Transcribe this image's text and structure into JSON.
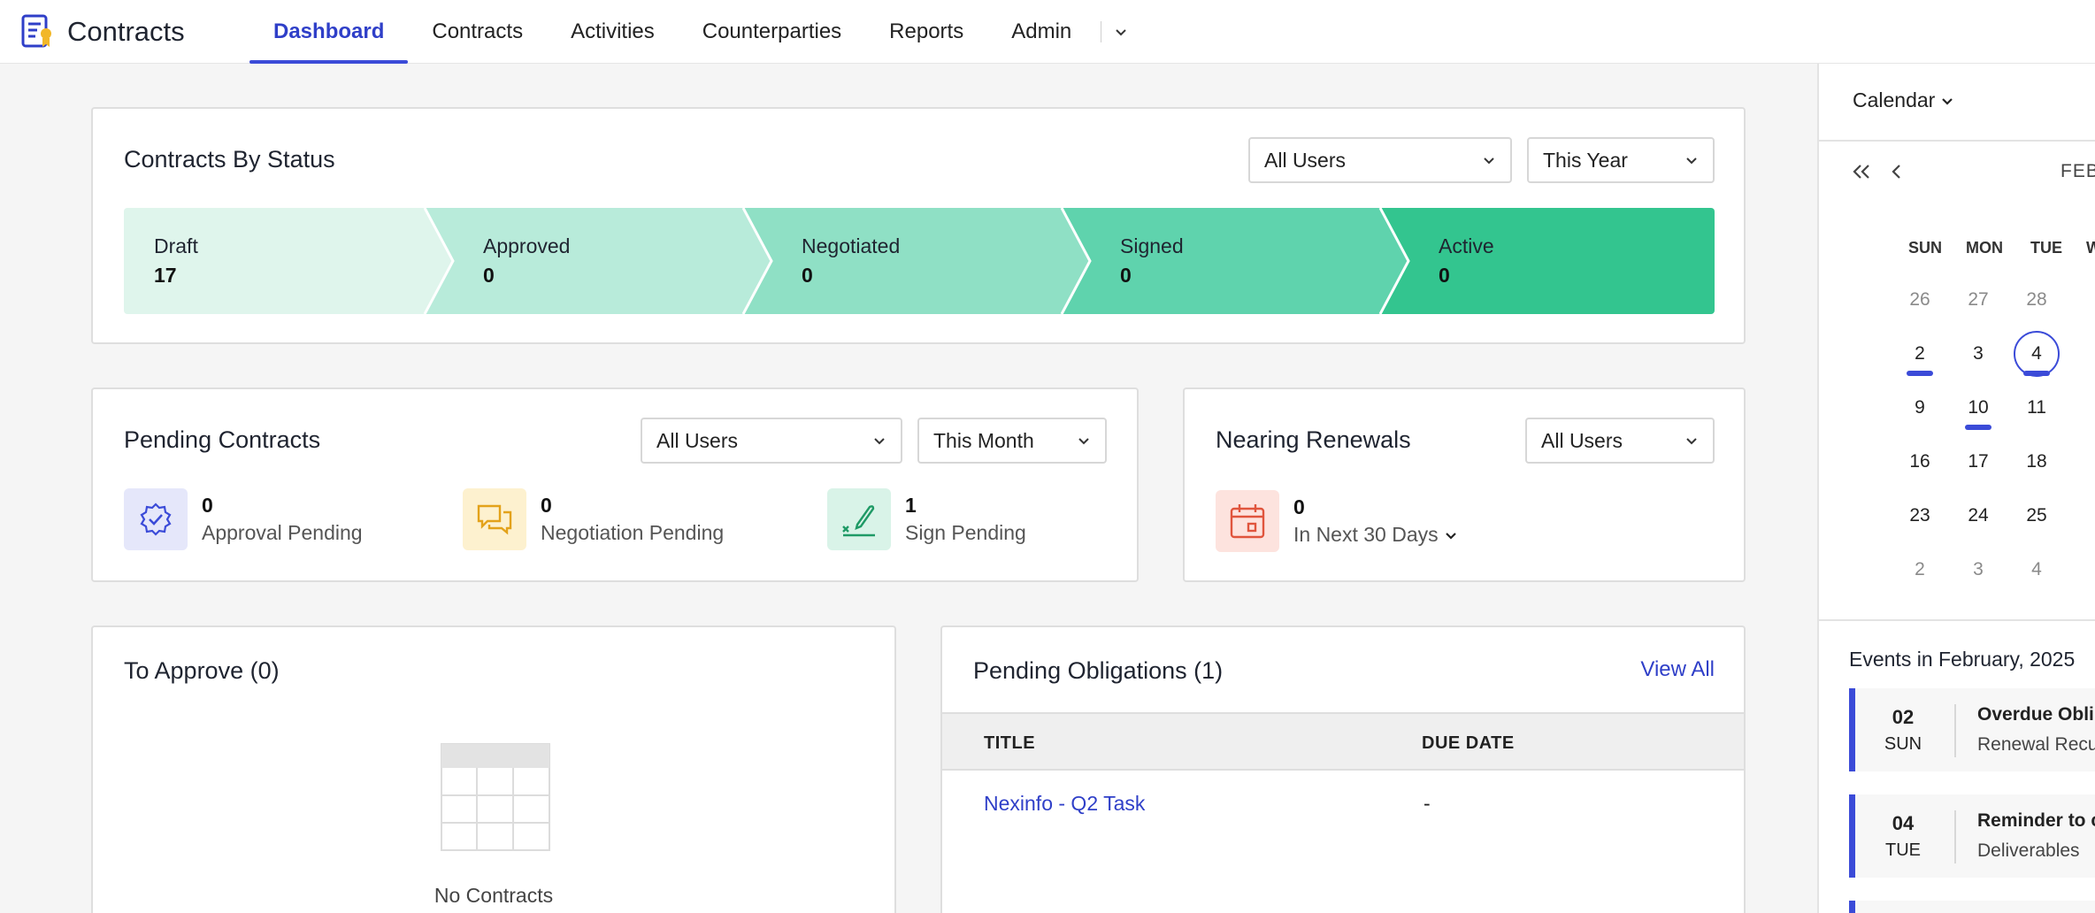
{
  "app": {
    "name": "Contracts"
  },
  "nav": {
    "tabs": [
      {
        "label": "Dashboard"
      },
      {
        "label": "Contracts"
      },
      {
        "label": "Activities"
      },
      {
        "label": "Counterparties"
      },
      {
        "label": "Reports"
      },
      {
        "label": "Admin"
      }
    ]
  },
  "status_card": {
    "title": "Contracts By Status",
    "filter_users": "All Users",
    "filter_period": "This Year",
    "stages": [
      {
        "name": "Draft",
        "count": "17",
        "color": "#dff5ec"
      },
      {
        "name": "Approved",
        "count": "0",
        "color": "#b8ebda"
      },
      {
        "name": "Negotiated",
        "count": "0",
        "color": "#8fe0c5"
      },
      {
        "name": "Signed",
        "count": "0",
        "color": "#5fd3ad"
      },
      {
        "name": "Active",
        "count": "0",
        "color": "#33c58f"
      }
    ]
  },
  "pending_card": {
    "title": "Pending Contracts",
    "filter_users": "All Users",
    "filter_period": "This Month",
    "items": [
      {
        "count": "0",
        "label": "Approval Pending",
        "icon": "verified-badge-icon",
        "bg": "#e5e7fa",
        "fg": "#3b4bd8"
      },
      {
        "count": "0",
        "label": "Negotiation Pending",
        "icon": "chat-bubbles-icon",
        "bg": "#fdf1cf",
        "fg": "#e3a21a"
      },
      {
        "count": "1",
        "label": "Sign Pending",
        "icon": "signature-pen-icon",
        "bg": "#d9f3e8",
        "fg": "#1f9a66"
      }
    ]
  },
  "renewals_card": {
    "title": "Nearing Renewals",
    "filter_users": "All Users",
    "count": "0",
    "period_label": "In Next 30 Days",
    "icon": "calendar-icon",
    "bg": "#fde3de",
    "fg": "#e0553d"
  },
  "approve_card": {
    "title": "To Approve (0)",
    "empty_text": "No Contracts"
  },
  "obligations_card": {
    "title": "Pending Obligations (1)",
    "view_all": "View All",
    "columns": [
      "TITLE",
      "DUE DATE"
    ],
    "rows": [
      {
        "title": "Nexinfo - Q2 Task",
        "due": "-"
      }
    ]
  },
  "calendar": {
    "header": "Calendar",
    "month_label": "FEB",
    "weekdays": [
      "SUN",
      "MON",
      "TUE",
      "W"
    ],
    "weeks": [
      [
        "26",
        "27",
        "28"
      ],
      [
        "2",
        "3",
        "4"
      ],
      [
        "9",
        "10",
        "11"
      ],
      [
        "16",
        "17",
        "18"
      ],
      [
        "23",
        "24",
        "25"
      ],
      [
        "2",
        "3",
        "4"
      ]
    ],
    "today": "4",
    "events_title": "Events in February, 2025",
    "events": [
      {
        "day": "02",
        "weekday": "SUN",
        "title": "Overdue Obli",
        "subtitle": "Renewal Recu"
      },
      {
        "day": "04",
        "weekday": "TUE",
        "title": "Reminder to c",
        "subtitle": "Deliverables"
      }
    ]
  },
  "colors": {
    "accent": "#3b4bd8",
    "link": "#2f3fc8"
  }
}
